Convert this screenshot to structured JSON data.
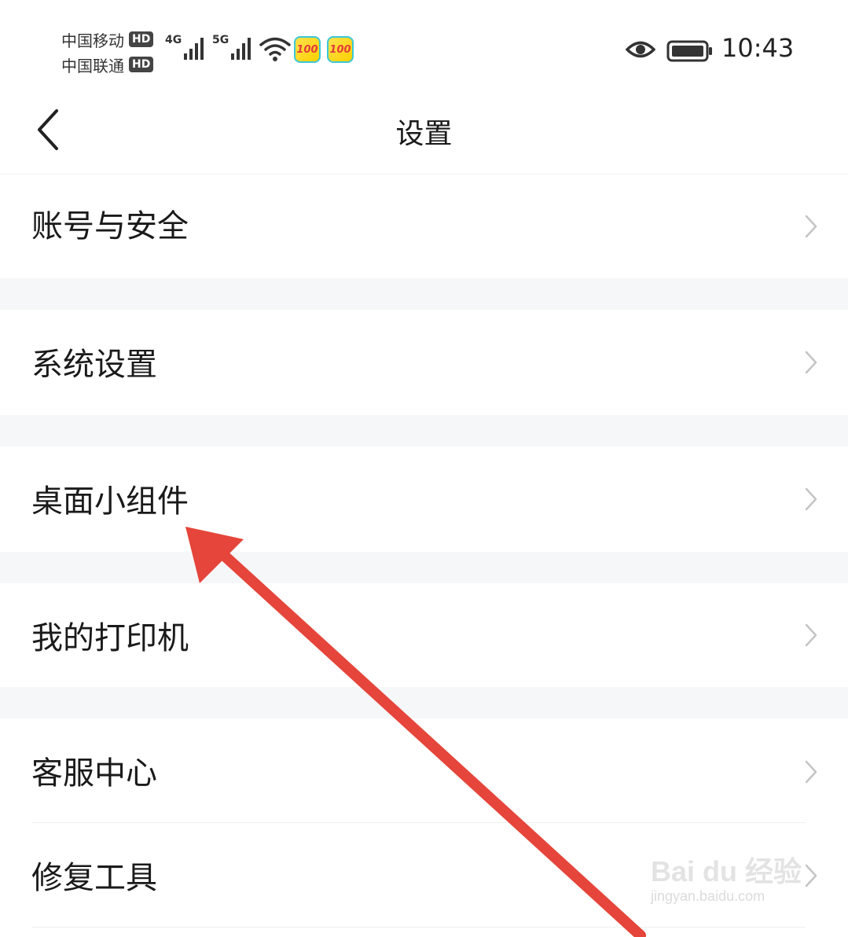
{
  "status_bar": {
    "carrier_1": "中国移动",
    "carrier_2": "中国联通",
    "hd_badge": "HD",
    "net_1": "4G",
    "net_2": "5G",
    "app_badge": "100",
    "time": "10:43"
  },
  "header": {
    "title": "设置"
  },
  "settings_items": [
    {
      "label": "账号与安全"
    },
    {
      "label": "系统设置"
    },
    {
      "label": "桌面小组件"
    },
    {
      "label": "我的打印机"
    },
    {
      "label": "客服中心"
    },
    {
      "label": "修复工具"
    }
  ],
  "watermark": {
    "logo": "Bai du 经验",
    "url": "jingyan.baidu.com"
  },
  "colors": {
    "annotation_arrow": "#e5453a",
    "section_gap": "#f6f7f9",
    "text_primary": "#1a1a1a",
    "chevron": "#c4c4c4"
  },
  "icons": {
    "back": "chevron-left-icon",
    "row_arrow": "chevron-right-icon",
    "wifi": "wifi-icon",
    "eye": "eye-icon",
    "battery": "battery-icon"
  }
}
